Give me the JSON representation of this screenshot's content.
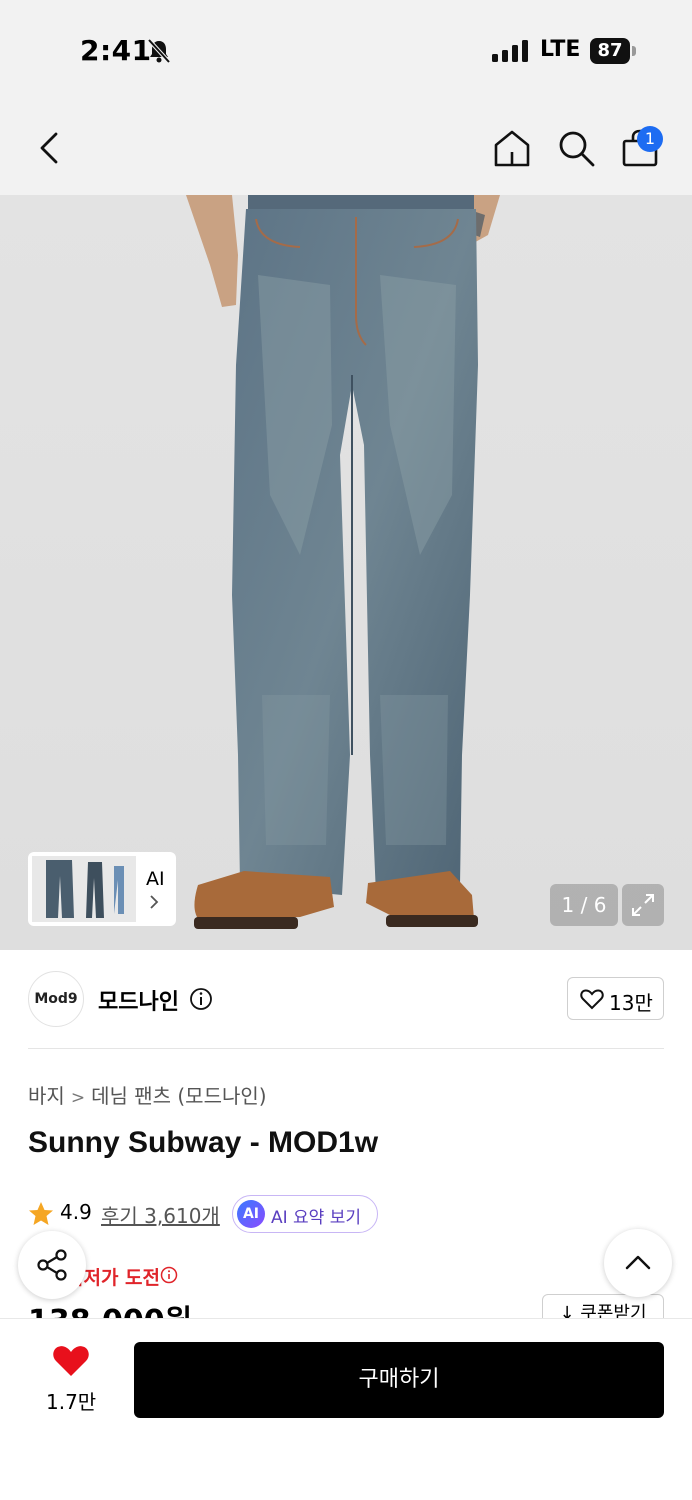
{
  "status_bar": {
    "time": "2:41",
    "network": "LTE",
    "battery": "87"
  },
  "nav": {
    "cart_count": "1"
  },
  "gallery": {
    "thumbnail_label": "AI",
    "counter": "1 / 6"
  },
  "brand": {
    "logo_text": "Mod9",
    "name": "모드나인",
    "like_count": "13만"
  },
  "product": {
    "breadcrumb": [
      "바지",
      "데님 팬츠 (모드나인)"
    ],
    "title": "Sunny Subway - MOD1w",
    "rating": "4.9",
    "reviews": "후기 3,610개",
    "ai_badge": "AI",
    "ai_summary": "AI 요약 보기",
    "promo": "최저가 도전",
    "price": "138,000원",
    "coupon": "↓ 쿠폰받기"
  },
  "bottom_bar": {
    "wish_count": "1.7만",
    "buy_label": "구매하기"
  },
  "colors": {
    "accent_blue": "#1d6cf2",
    "sale_red": "#e0242a",
    "heart_red": "#e8101c",
    "star": "#f5a623"
  }
}
